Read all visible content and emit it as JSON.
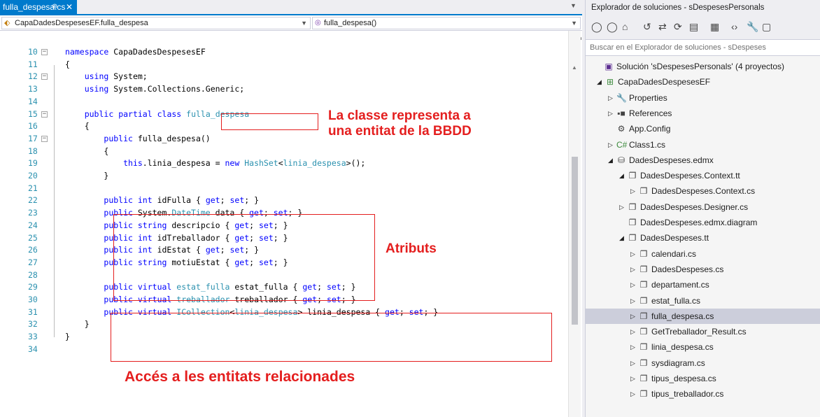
{
  "editor": {
    "tab_label": "fulla_despesa.cs",
    "tab_pin": "⊕",
    "tab_close": "✕",
    "nav_left": "CapaDadesDespesesEF.fulla_despesa",
    "nav_right": "fulla_despesa()",
    "lines": [
      {
        "n": "10",
        "html": "<span class='kw'>namespace</span> CapaDadesDespesesEF"
      },
      {
        "n": "11",
        "html": "{"
      },
      {
        "n": "12",
        "html": "    <span class='kw'>using</span> System;"
      },
      {
        "n": "13",
        "html": "    <span class='kw'>using</span> System.Collections.Generic;"
      },
      {
        "n": "14",
        "html": ""
      },
      {
        "n": "15",
        "html": "    <span class='kw'>public</span> <span class='kw'>partial</span> <span class='kw'>class</span> <span class='ty'>fulla_despesa</span>"
      },
      {
        "n": "16",
        "html": "    {"
      },
      {
        "n": "17",
        "html": "        <span class='kw'>public</span> fulla_despesa()"
      },
      {
        "n": "18",
        "html": "        {"
      },
      {
        "n": "19",
        "html": "            <span class='kw'>this</span>.linia_despesa = <span class='kw'>new</span> <span class='ty'>HashSet</span>&lt;<span class='ty'>linia_despesa</span>&gt;();"
      },
      {
        "n": "20",
        "html": "        }"
      },
      {
        "n": "21",
        "html": ""
      },
      {
        "n": "22",
        "html": "        <span class='kw'>public</span> <span class='kw'>int</span> idFulla { <span class='kw'>get</span>; <span class='kw'>set</span>; }"
      },
      {
        "n": "23",
        "html": "        <span class='kw'>public</span> System.<span class='ty'>DateTime</span> data { <span class='kw'>get</span>; <span class='kw'>set</span>; }"
      },
      {
        "n": "24",
        "html": "        <span class='kw'>public</span> <span class='kw'>string</span> descripcio { <span class='kw'>get</span>; <span class='kw'>set</span>; }"
      },
      {
        "n": "25",
        "html": "        <span class='kw'>public</span> <span class='kw'>int</span> idTreballador { <span class='kw'>get</span>; <span class='kw'>set</span>; }"
      },
      {
        "n": "26",
        "html": "        <span class='kw'>public</span> <span class='kw'>int</span> idEstat { <span class='kw'>get</span>; <span class='kw'>set</span>; }"
      },
      {
        "n": "27",
        "html": "        <span class='kw'>public</span> <span class='kw'>string</span> motiuEstat { <span class='kw'>get</span>; <span class='kw'>set</span>; }"
      },
      {
        "n": "28",
        "html": ""
      },
      {
        "n": "29",
        "html": "        <span class='kw'>public</span> <span class='kw'>virtual</span> <span class='ty'>estat_fulla</span> estat_fulla { <span class='kw'>get</span>; <span class='kw'>set</span>; }"
      },
      {
        "n": "30",
        "html": "        <span class='kw'>public</span> <span class='kw'>virtual</span> <span class='ty'>treballador</span> treballador { <span class='kw'>get</span>; <span class='kw'>set</span>; }"
      },
      {
        "n": "31",
        "html": "        <span class='kw'>public</span> <span class='kw'>virtual</span> <span class='ty'>ICollection</span>&lt;<span class='ty'>linia_despesa</span>&gt; linia_despesa { <span class='kw'>get</span>; <span class='kw'>set</span>; }"
      },
      {
        "n": "32",
        "html": "    }"
      },
      {
        "n": "33",
        "html": "}"
      },
      {
        "n": "34",
        "html": ""
      }
    ]
  },
  "annotations": {
    "class_note": "La classe representa a\nuna entitat de la BBDD",
    "attributes_note": "Atributs",
    "relations_note": "Accés a les entitats relacionades"
  },
  "solution_explorer": {
    "title": "Explorador de soluciones - sDespesesPersonals",
    "search_placeholder": "Buscar en el Explorador de soluciones - sDespeses",
    "toolbar_icons": [
      "back-icon",
      "forward-icon",
      "home-icon",
      "history-icon",
      "sync-icon",
      "refresh-icon",
      "collapse-all-icon",
      "show-all-files-icon",
      "view-code-icon",
      "properties-icon",
      "preview-icon"
    ],
    "items": [
      {
        "label": "Solución 'sDespesesPersonals'  (4 proyectos)",
        "depth": 0,
        "arrow": "",
        "icon": "▣",
        "icon_color": "#5c2d91"
      },
      {
        "label": "CapaDadesDespesesEF",
        "depth": 1,
        "arrow": "◢",
        "icon": "⊞",
        "icon_color": "#3c8a3c"
      },
      {
        "label": "Properties",
        "depth": 2,
        "arrow": "▷",
        "icon": "🔧",
        "icon_color": "#424242"
      },
      {
        "label": "References",
        "depth": 2,
        "arrow": "▷",
        "icon": "▪■",
        "icon_color": "#424242"
      },
      {
        "label": "App.Config",
        "depth": 2,
        "arrow": "",
        "icon": "⚙",
        "icon_color": "#424242"
      },
      {
        "label": "Class1.cs",
        "depth": 2,
        "arrow": "▷",
        "icon": "C#",
        "icon_color": "#3c8a3c"
      },
      {
        "label": "DadesDespeses.edmx",
        "depth": 2,
        "arrow": "◢",
        "icon": "⛁",
        "icon_color": "#424242"
      },
      {
        "label": "DadesDespeses.Context.tt",
        "depth": 3,
        "arrow": "◢",
        "icon": "❐",
        "icon_color": "#424242"
      },
      {
        "label": "DadesDespeses.Context.cs",
        "depth": 4,
        "arrow": "▷",
        "icon": "❐",
        "icon_color": "#424242"
      },
      {
        "label": "DadesDespeses.Designer.cs",
        "depth": 3,
        "arrow": "▷",
        "icon": "❐",
        "icon_color": "#424242"
      },
      {
        "label": "DadesDespeses.edmx.diagram",
        "depth": 3,
        "arrow": "",
        "icon": "❐",
        "icon_color": "#424242"
      },
      {
        "label": "DadesDespeses.tt",
        "depth": 3,
        "arrow": "◢",
        "icon": "❐",
        "icon_color": "#424242"
      },
      {
        "label": "calendari.cs",
        "depth": 4,
        "arrow": "▷",
        "icon": "❐",
        "icon_color": "#424242"
      },
      {
        "label": "DadesDespeses.cs",
        "depth": 4,
        "arrow": "▷",
        "icon": "❐",
        "icon_color": "#424242"
      },
      {
        "label": "departament.cs",
        "depth": 4,
        "arrow": "▷",
        "icon": "❐",
        "icon_color": "#424242"
      },
      {
        "label": "estat_fulla.cs",
        "depth": 4,
        "arrow": "▷",
        "icon": "❐",
        "icon_color": "#424242"
      },
      {
        "label": "fulla_despesa.cs",
        "depth": 4,
        "arrow": "▷",
        "icon": "❐",
        "icon_color": "#424242",
        "selected": true
      },
      {
        "label": "GetTreballador_Result.cs",
        "depth": 4,
        "arrow": "▷",
        "icon": "❐",
        "icon_color": "#424242"
      },
      {
        "label": "linia_despesa.cs",
        "depth": 4,
        "arrow": "▷",
        "icon": "❐",
        "icon_color": "#424242"
      },
      {
        "label": "sysdiagram.cs",
        "depth": 4,
        "arrow": "▷",
        "icon": "❐",
        "icon_color": "#424242"
      },
      {
        "label": "tipus_despesa.cs",
        "depth": 4,
        "arrow": "▷",
        "icon": "❐",
        "icon_color": "#424242"
      },
      {
        "label": "tipus_treballador.cs",
        "depth": 4,
        "arrow": "▷",
        "icon": "❐",
        "icon_color": "#424242"
      }
    ]
  },
  "colors": {
    "accent": "#007acc",
    "annotation_red": "#e41e1e",
    "keyword_blue": "#0000ff",
    "type_teal": "#2b91af"
  }
}
